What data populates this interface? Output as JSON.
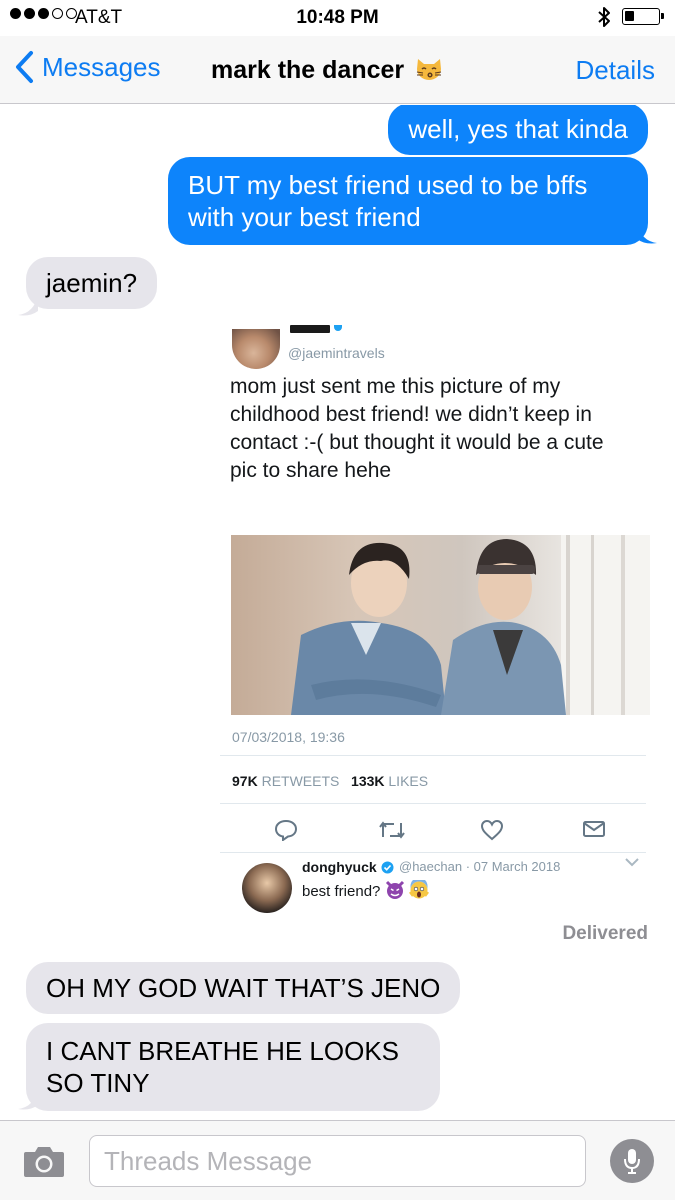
{
  "status_bar": {
    "carrier": "AT&T",
    "time": "10:48 PM",
    "signal_bars_filled": 3,
    "signal_bars_total": 5,
    "bluetooth_icon": "bluetooth-icon",
    "battery_level": 0.25
  },
  "nav": {
    "back_label": "Messages",
    "title": "mark the dancer",
    "title_emoji": "kissing-cat-emoji",
    "details_label": "Details"
  },
  "messages": [
    {
      "direction": "sent",
      "text": "well, yes that kinda"
    },
    {
      "direction": "sent",
      "lines": [
        "BUT my best friend used to be bffs",
        "with your best friend"
      ]
    },
    {
      "direction": "received",
      "text": "jaemin?"
    }
  ],
  "tweet": {
    "handle": "@jaemintravels",
    "text_lines": [
      "mom just sent me this picture of my",
      "childhood best friend! we didn’t keep in",
      "contact :-( but thought it would be a cute",
      "pic to share hehe"
    ],
    "date": "07/03/2018, 19:36",
    "retweets_count": "97K",
    "retweets_label": "RETWEETS",
    "likes_count": "133K",
    "likes_label": "LIKES",
    "actions": [
      "reply-icon",
      "retweet-icon",
      "heart-icon",
      "message-icon"
    ],
    "reply": {
      "name": "donghyuck",
      "meta": "@haechan · 07 March 2018",
      "text": "best friend?",
      "emojis": [
        "devil-face-emoji",
        "screaming-face-emoji"
      ]
    }
  },
  "delivered_label": "Delivered",
  "messages_after": [
    {
      "direction": "received",
      "text": "OH MY GOD WAIT THAT’S JENO"
    },
    {
      "direction": "received",
      "lines": [
        "I CANT BREATHE HE LOOKS",
        "SO TINY"
      ]
    }
  ],
  "input": {
    "placeholder": "Threads Message",
    "camera_icon": "camera-icon",
    "mic_icon": "microphone-icon"
  },
  "colors": {
    "ios_blue": "#0d84fb",
    "received_bubble": "#e6e5eb",
    "twitter_gray": "#8899a6"
  }
}
